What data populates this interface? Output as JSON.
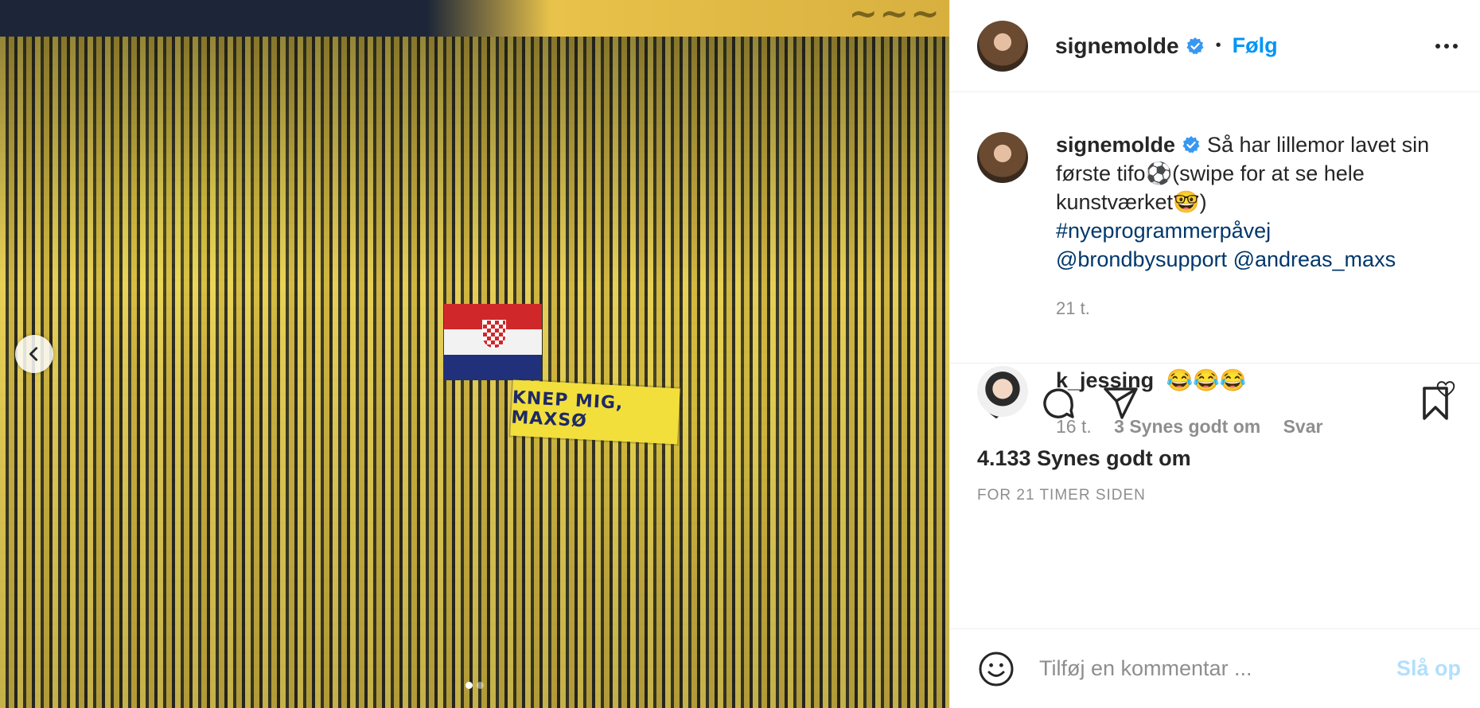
{
  "post": {
    "username": "signemolde",
    "verified": true,
    "follow_label": "Følg",
    "separator": "•",
    "caption": "Så har lillemor lavet sin første tifo⚽️(swipe for at se hele kunstværket🤓)",
    "hashtag": "#nyeprogrammerpåvej",
    "mentions": [
      "@brondbysupport",
      "@andreas_maxs"
    ],
    "caption_time": "21 t.",
    "likes": "4.133 Synes godt om",
    "posted_ago": "FOR 21 TIMER SIDEN",
    "image_texts": {
      "banner": "KNEP MIG, MAXSØ"
    },
    "carousel": {
      "count": 2,
      "active_index": 0
    }
  },
  "comments": [
    {
      "username": "k_jessing",
      "text": "😂😂😂",
      "time": "16 t.",
      "likes": "3 Synes godt om",
      "reply_label": "Svar"
    }
  ],
  "comment_box": {
    "placeholder": "Tilføj en kommentar ...",
    "post_label": "Slå op"
  },
  "icons": {
    "verified": "verified-badge-icon",
    "more": "more-options-icon",
    "like": "heart-icon",
    "comment": "comment-icon",
    "share": "paper-plane-icon",
    "save": "bookmark-icon",
    "emoji": "emoji-icon",
    "prev": "chevron-left-icon"
  },
  "colors": {
    "accent": "#0095f6",
    "verified": "#3897f0",
    "link": "#00376b",
    "muted": "#8e8e8e",
    "post_disabled": "#b2dffc"
  }
}
